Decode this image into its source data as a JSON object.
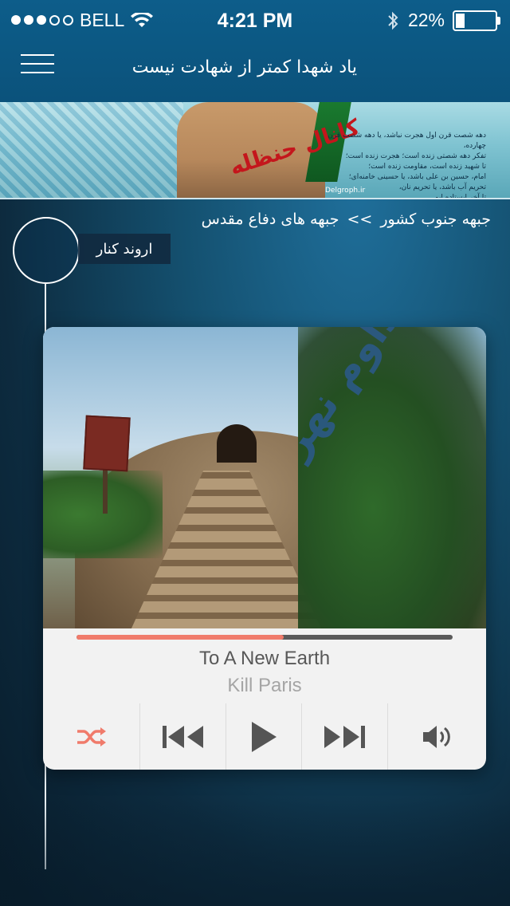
{
  "status_bar": {
    "carrier": "BELL",
    "time": "4:21 PM",
    "battery_text": "22%",
    "battery_level": 0.22,
    "signal_filled": 3,
    "signal_total": 5
  },
  "navbar": {
    "title": "یاد شهدا کمتر از شهادت نیست"
  },
  "banner": {
    "graffiti": "کانال حنظله",
    "watermark": "Delgroph.ir",
    "lines": [
      "دهه شصت قرن اول هجرت نباشد، یا دهه شصت قرن چهارده،",
      "تفکر دهه شصتی زنده است؛ هجرت زنده است؛",
      "تا شهید زنده است، مقاومت زنده است؛",
      "امام، حسین بن علی باشد، یا حسینی خامنه‌ای؛",
      "تحریم آب باشد، یا تحریم نان،",
      "تا آخر ایستاده ایم."
    ]
  },
  "breadcrumb": {
    "level1": "جبهه های دفاع مقدس",
    "separator": ">>",
    "level2": "جبهه جنوب کشور"
  },
  "timeline": {
    "node_label": "اروند کنار"
  },
  "player": {
    "track_title": "To A New Earth",
    "artist": "Kill Paris",
    "progress": 0.55,
    "cover_calligraphy": "تداوم نهر",
    "colors": {
      "accent": "#f07b6b",
      "icon": "#555555",
      "track": "#5a5a5a"
    },
    "controls": [
      "shuffle",
      "previous",
      "play",
      "next",
      "volume"
    ]
  }
}
